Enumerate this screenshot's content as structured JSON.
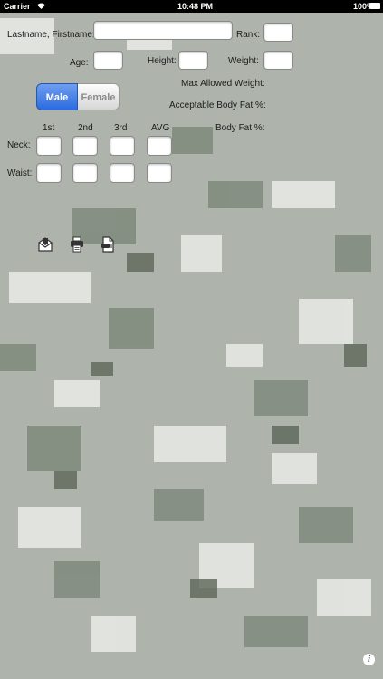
{
  "status_bar": {
    "carrier": "Carrier",
    "time": "10:48 PM",
    "battery": "100%"
  },
  "form": {
    "name_label": "Lastname, Firstname:",
    "rank_label": "Rank:",
    "age_label": "Age:",
    "height_label": "Height:",
    "weight_label": "Weight:",
    "max_weight_label": "Max Allowed Weight:",
    "acceptable_bf_label": "Acceptable Body Fat %:",
    "body_fat_label": "Body Fat %:"
  },
  "gender": {
    "male": "Male",
    "female": "Female",
    "selected": "Male"
  },
  "measurements": {
    "columns": [
      "1st",
      "2nd",
      "3rd",
      "AVG"
    ],
    "rows": [
      "Neck:",
      "Waist:"
    ]
  },
  "actions": {
    "icons": [
      "email-icon",
      "print-icon",
      "document-icon"
    ]
  },
  "info_glyph": "i",
  "colors": {
    "accent": "#2b6be0",
    "camo_base": "#aeb4ab"
  }
}
